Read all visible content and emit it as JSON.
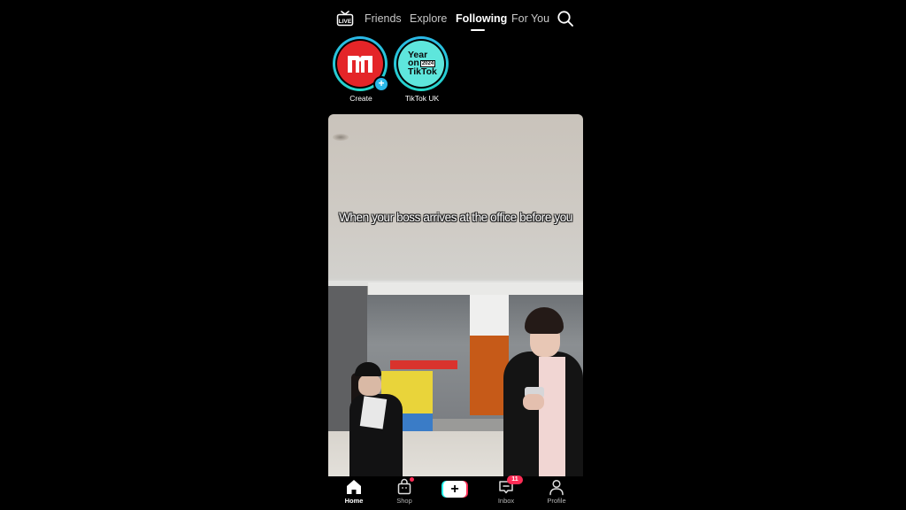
{
  "top_nav": {
    "live_label": "LIVE",
    "tabs": [
      {
        "label": "Friends",
        "active": false
      },
      {
        "label": "Explore",
        "active": false
      },
      {
        "label": "Following",
        "active": true
      },
      {
        "label": "For You",
        "active": false
      }
    ],
    "search_icon": "search-icon"
  },
  "stories": [
    {
      "label": "Create",
      "avatar": "m-logo",
      "badge": "+"
    },
    {
      "label": "TikTok UK",
      "avatar_lines": [
        "Year",
        "on",
        "TikTok"
      ],
      "avatar_badge": "2024"
    }
  ],
  "video": {
    "caption": "When your boss arrives at the office before you"
  },
  "bottom_nav": {
    "items": [
      {
        "label": "Home",
        "icon": "home-icon",
        "active": true
      },
      {
        "label": "Shop",
        "icon": "shop-bag-icon",
        "has_dot": true
      },
      {
        "label": "",
        "icon": "create-plus-icon",
        "glyph": "+"
      },
      {
        "label": "Inbox",
        "icon": "inbox-icon",
        "badge": "11"
      },
      {
        "label": "Profile",
        "icon": "profile-icon"
      }
    ]
  },
  "colors": {
    "accent_cyan": "#25f4ee",
    "accent_red": "#fe2c55",
    "story_ring": "#2ab7e8",
    "create_avatar_red": "#e42528",
    "yot_avatar_teal": "#5ee6dc"
  }
}
